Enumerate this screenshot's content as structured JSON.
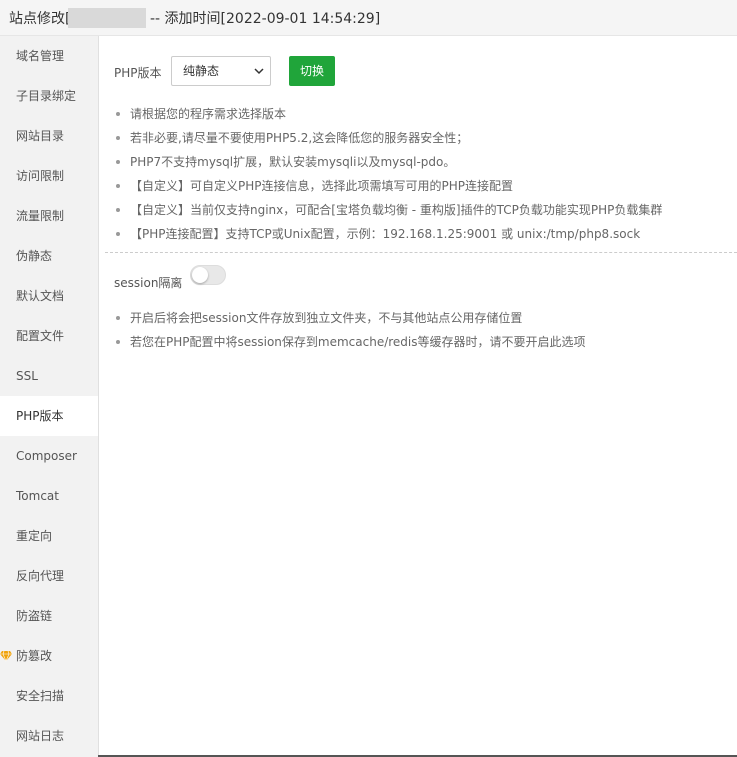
{
  "titlebar": {
    "prefix": "站点修改[",
    "suffix": "-- 添加时间[2022-09-01 14:54:29]"
  },
  "sidebar": {
    "items": [
      {
        "label": "域名管理"
      },
      {
        "label": "子目录绑定"
      },
      {
        "label": "网站目录"
      },
      {
        "label": "访问限制"
      },
      {
        "label": "流量限制"
      },
      {
        "label": "伪静态"
      },
      {
        "label": "默认文档"
      },
      {
        "label": "配置文件"
      },
      {
        "label": "SSL"
      },
      {
        "label": "PHP版本",
        "active": true
      },
      {
        "label": "Composer"
      },
      {
        "label": "Tomcat"
      },
      {
        "label": "重定向"
      },
      {
        "label": "反向代理"
      },
      {
        "label": "防盗链"
      },
      {
        "label": "防篡改",
        "icon": "diamond-icon"
      },
      {
        "label": "安全扫描"
      },
      {
        "label": "网站日志"
      }
    ]
  },
  "php": {
    "label": "PHP版本",
    "selected": "纯静态",
    "switch_label": "切换",
    "tips": [
      "请根据您的程序需求选择版本",
      "若非必要,请尽量不要使用PHP5.2,这会降低您的服务器安全性；",
      "PHP7不支持mysql扩展，默认安装mysqli以及mysql-pdo。",
      "【自定义】可自定义PHP连接信息，选择此项需填写可用的PHP连接配置",
      "【自定义】当前仅支持nginx，可配合[宝塔负载均衡 - 重构版]插件的TCP负载功能实现PHP负载集群",
      "【PHP连接配置】支持TCP或Unix配置，示例：192.168.1.25:9001 或 unix:/tmp/php8.sock"
    ]
  },
  "session": {
    "label": "session隔离",
    "enabled": false,
    "tips": [
      "开启后将会把session文件存放到独立文件夹，不与其他站点公用存储位置",
      "若您在PHP配置中将session保存到memcache/redis等缓存器时，请不要开启此选项"
    ]
  },
  "colors": {
    "accent": "#20a53a",
    "diamond": "#f0a30a"
  }
}
